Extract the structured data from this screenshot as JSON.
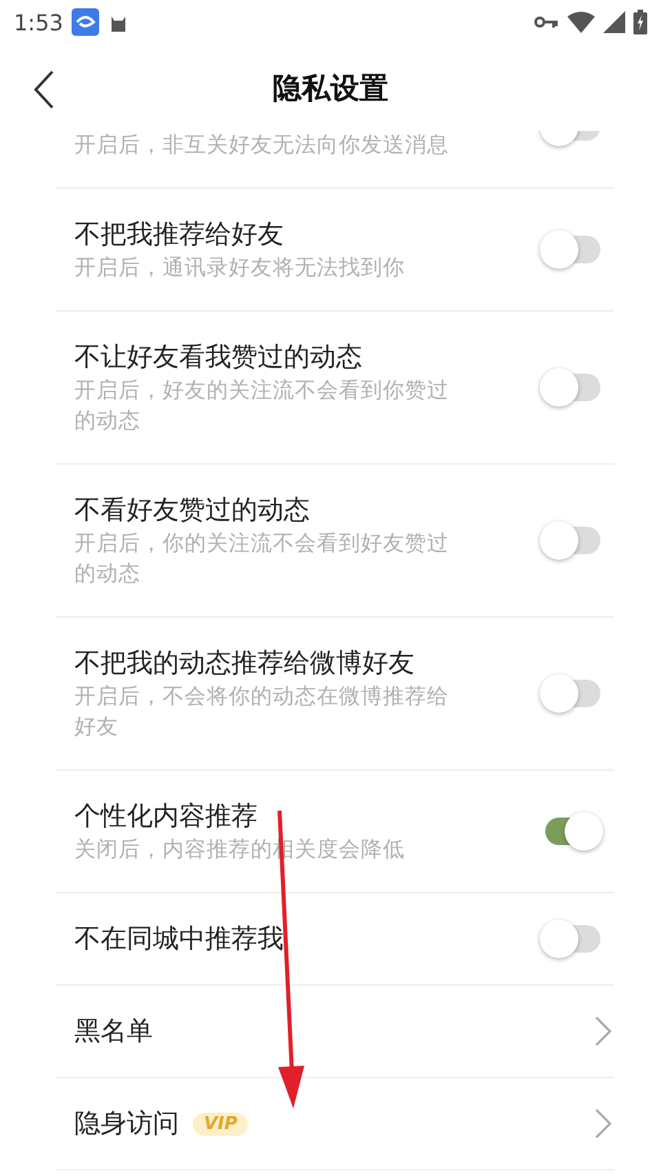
{
  "status_bar": {
    "time": "1:53"
  },
  "header": {
    "title": "隐私设置"
  },
  "rows": [
    {
      "kind": "toggle",
      "subtitle": "开启后，非互关好友无法向你发送消息",
      "on": false
    },
    {
      "kind": "toggle",
      "title": "不把我推荐给好友",
      "subtitle": "开启后，通讯录好友将无法找到你",
      "on": false
    },
    {
      "kind": "toggle",
      "title": "不让好友看我赞过的动态",
      "subtitle": "开启后，好友的关注流不会看到你赞过的动态",
      "on": false
    },
    {
      "kind": "toggle",
      "title": "不看好友赞过的动态",
      "subtitle": "开启后，你的关注流不会看到好友赞过的动态",
      "on": false
    },
    {
      "kind": "toggle",
      "title": "不把我的动态推荐给微博好友",
      "subtitle": "开启后，不会将你的动态在微博推荐给好友",
      "on": false
    },
    {
      "kind": "toggle",
      "title": "个性化内容推荐",
      "subtitle": "关闭后，内容推荐的相关度会降低",
      "on": true
    },
    {
      "kind": "toggle",
      "title": "不在同城中推荐我",
      "on": false
    },
    {
      "kind": "link",
      "title": "黑名单"
    },
    {
      "kind": "link",
      "title": "隐身访问",
      "badge": "VIP"
    }
  ]
}
